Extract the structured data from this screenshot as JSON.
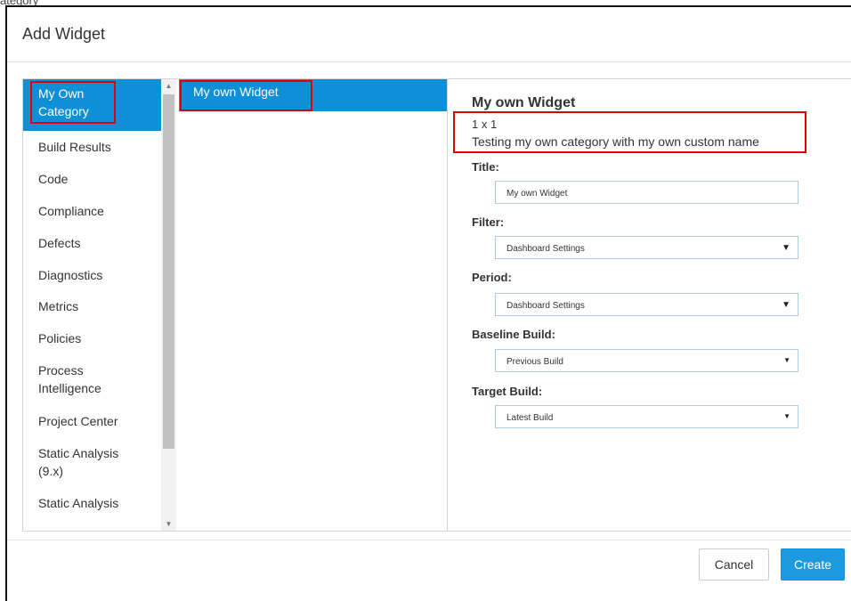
{
  "topcut_text": "ategory",
  "dialog": {
    "title": "Add Widget"
  },
  "categories": [
    "My Own Category",
    "Build Results",
    "Code",
    "Compliance",
    "Defects",
    "Diagnostics",
    "Metrics",
    "Policies",
    "Process Intelligence",
    "Project Center",
    "Static Analysis (9.x)",
    "Static Analysis"
  ],
  "selected_category": {
    "line1": "My Own",
    "line2": "Category"
  },
  "widgets": [
    "My own Widget"
  ],
  "details": {
    "name": "My own Widget",
    "size": "1 x 1",
    "description": "Testing my own category with my own custom name",
    "title_label": "Title:",
    "title_value": "My own Widget",
    "filter_label": "Filter:",
    "filter_value": "Dashboard Settings",
    "period_label": "Period:",
    "period_value": "Dashboard Settings",
    "baseline_label": "Baseline Build:",
    "baseline_value": "Previous Build",
    "target_label": "Target Build:",
    "target_value": "Latest Build"
  },
  "buttons": {
    "cancel": "Cancel",
    "create": "Create"
  },
  "colors": {
    "selection": "#0f8fd5",
    "primary_button": "#1b9ae0",
    "highlight_box": "#e00000"
  },
  "icons": {
    "dropdown": "caret-down-icon",
    "scroll_up": "scroll-up-icon",
    "scroll_down": "scroll-down-icon"
  }
}
